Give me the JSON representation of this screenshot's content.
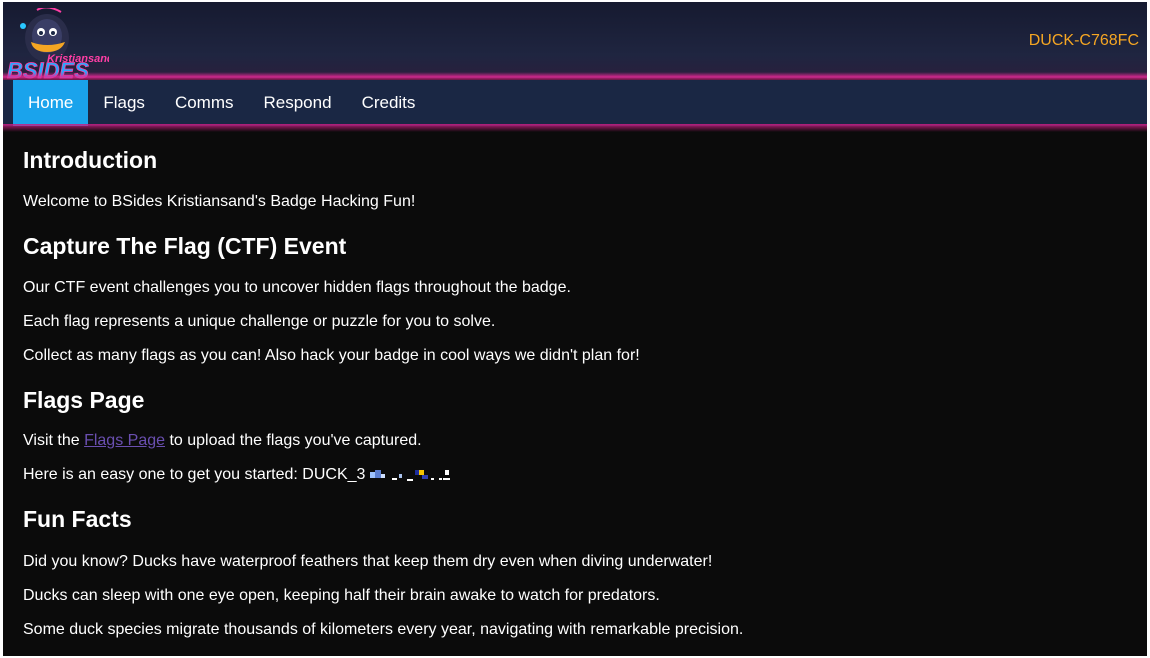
{
  "header": {
    "logo_line1": "Kristiansand",
    "logo_line2": "BSIDES",
    "device_id": "DUCK-C768FC"
  },
  "nav": {
    "items": [
      {
        "label": "Home",
        "active": true
      },
      {
        "label": "Flags",
        "active": false
      },
      {
        "label": "Comms",
        "active": false
      },
      {
        "label": "Respond",
        "active": false
      },
      {
        "label": "Credits",
        "active": false
      }
    ]
  },
  "sections": {
    "intro": {
      "heading": "Introduction",
      "text": "Welcome to BSides Kristiansand's Badge Hacking Fun!"
    },
    "ctf": {
      "heading": "Capture The Flag (CTF) Event",
      "paragraphs": [
        "Our CTF event challenges you to uncover hidden flags throughout the badge.",
        "Each flag represents a unique challenge or puzzle for you to solve.",
        "Collect as many flags as you can! Also hack your badge in cool ways we didn't plan for!"
      ]
    },
    "flags": {
      "heading": "Flags Page",
      "visit_prefix": "Visit the ",
      "link_text": "Flags Page",
      "visit_suffix": " to upload the flags you've captured.",
      "starter_text": "Here is an easy one to get you started: DUCK_3"
    },
    "fun": {
      "heading": "Fun Facts",
      "paragraphs": [
        "Did you know? Ducks have waterproof feathers that keep them dry even when diving underwater!",
        "Ducks can sleep with one eye open, keeping half their brain awake to watch for predators.",
        "Some duck species migrate thousands of kilometers every year, navigating with remarkable precision."
      ]
    }
  },
  "colors": {
    "background": "#0b0b0b",
    "nav_background": "#1a2744",
    "nav_active": "#1aa3ec",
    "accent_glow": "#e62896",
    "device_id": "#f5a623",
    "link": "#6a4fb0"
  }
}
